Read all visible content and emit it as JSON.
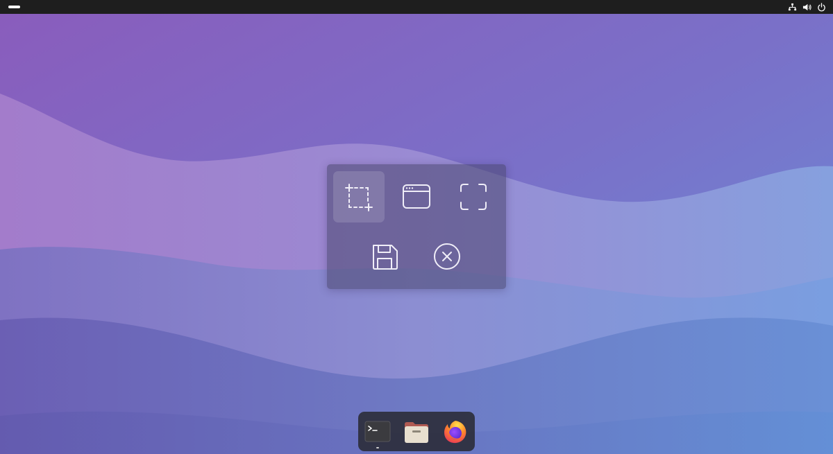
{
  "topbar": {
    "activities_icon": "activities-dash",
    "tray_icons": [
      "network-icon",
      "volume-icon",
      "power-icon"
    ]
  },
  "screenshot_panel": {
    "modes": [
      {
        "icon": "selection-area-icon",
        "selected": true
      },
      {
        "icon": "window-icon",
        "selected": false
      },
      {
        "icon": "fullscreen-icon",
        "selected": false
      }
    ],
    "actions": [
      {
        "icon": "save-icon"
      },
      {
        "icon": "close-circle-icon"
      }
    ]
  },
  "dock": {
    "apps": [
      {
        "icon": "terminal-icon",
        "running": true
      },
      {
        "icon": "files-folder-icon",
        "running": false
      },
      {
        "icon": "firefox-icon",
        "running": false
      }
    ]
  },
  "colors": {
    "topbar": "#1e1e1e",
    "wallpaper_top": "#8a63c0",
    "wallpaper_bottom": "#5e86d2",
    "panel_bg": "rgba(72,70,110,0.55)",
    "icon_stroke": "#f0eef8"
  }
}
